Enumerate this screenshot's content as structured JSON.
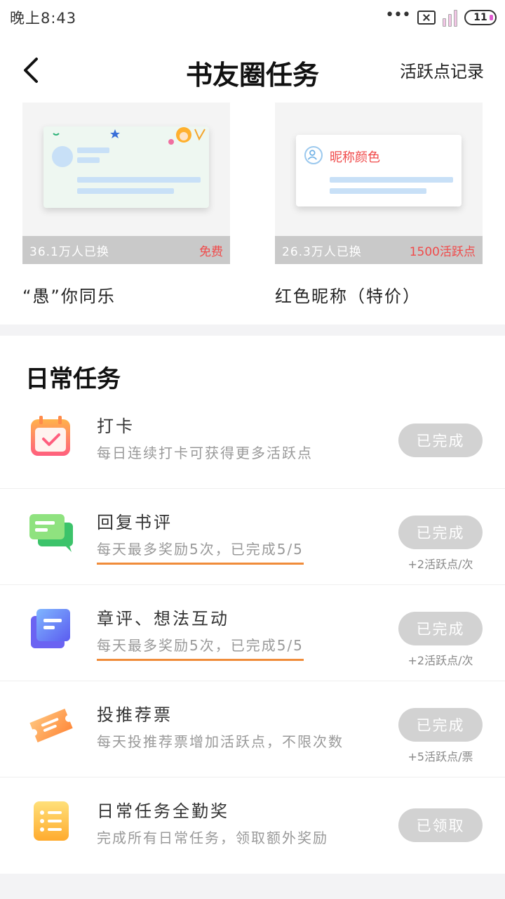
{
  "status_bar": {
    "time": "晚上8:43",
    "battery": "11"
  },
  "header": {
    "title": "书友圈任务",
    "record_link": "活跃点记录"
  },
  "cards": [
    {
      "count": "36.1万人已换",
      "price": "免费",
      "name": "“愚”你同乐"
    },
    {
      "count": "26.3万人已换",
      "price": "1500活跃点",
      "name": "红色昵称（特价）",
      "preview_label": "昵称颜色"
    }
  ],
  "section": {
    "title": "日常任务"
  },
  "tasks": [
    {
      "name": "打卡",
      "desc": "每日连续打卡可获得更多活跃点",
      "button": "已完成",
      "reward": "",
      "icon": "calendar-check-icon"
    },
    {
      "name": "回复书评",
      "desc": "每天最多奖励5次，已完成5/5",
      "button": "已完成",
      "reward": "+2活跃点/次",
      "icon": "chat-bubble-icon"
    },
    {
      "name": "章评、想法互动",
      "desc": "每天最多奖励5次，已完成5/5",
      "button": "已完成",
      "reward": "+2活跃点/次",
      "icon": "note-stack-icon"
    },
    {
      "name": "投推荐票",
      "desc": "每天投推荐票增加活跃点，不限次数",
      "button": "已完成",
      "reward": "+5活跃点/票",
      "icon": "ticket-icon"
    },
    {
      "name": "日常任务全勤奖",
      "desc": "完成所有日常任务，领取额外奖励",
      "button": "已领取",
      "reward": "",
      "icon": "list-icon"
    }
  ],
  "colors": {
    "accent_red": "#f04a4a",
    "underline_orange": "#f08c3a",
    "button_gray": "#d2d2d2"
  }
}
